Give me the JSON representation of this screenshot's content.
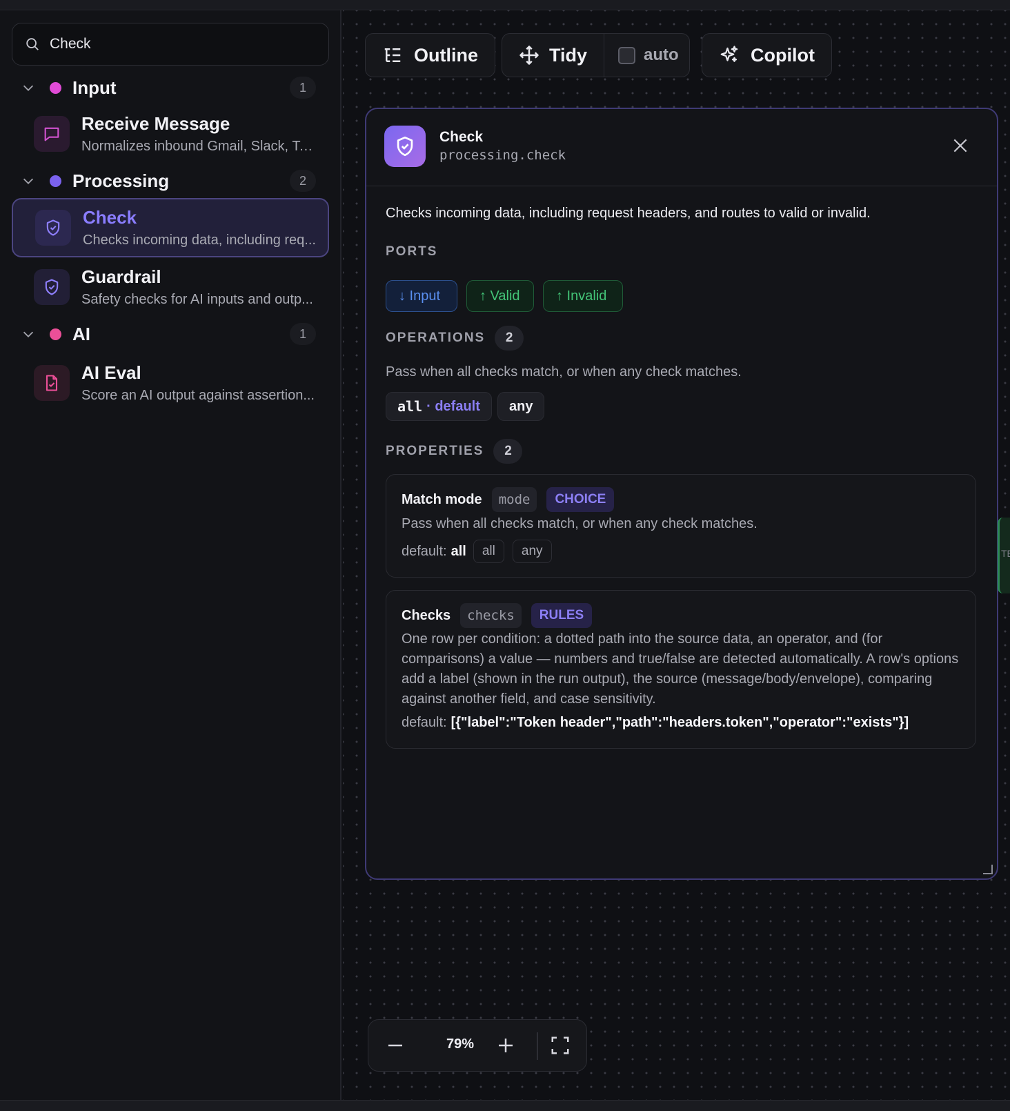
{
  "search": {
    "value": "Check"
  },
  "groups": [
    {
      "name": "Input",
      "count": "1",
      "color": "#e04bd6"
    },
    {
      "name": "Processing",
      "count": "2",
      "color": "#7b62ee"
    },
    {
      "name": "AI",
      "count": "1",
      "color": "#ec4f98"
    }
  ],
  "items": [
    {
      "title": "Receive Message",
      "desc": "Normalizes inbound Gmail, Slack, Tel...",
      "icon": "message-square-icon"
    },
    {
      "title": "Check",
      "desc": "Checks incoming data, including req...",
      "icon": "shield-check-icon"
    },
    {
      "title": "Guardrail",
      "desc": "Safety checks for AI inputs and outp...",
      "icon": "shield-check-icon"
    },
    {
      "title": "AI Eval",
      "desc": "Score an AI output against assertion...",
      "icon": "file-check-icon"
    }
  ],
  "toolbar": {
    "outline": "Outline",
    "tidy": "Tidy",
    "auto": "auto",
    "copilot": "Copilot"
  },
  "panel": {
    "title": "Check",
    "id": "processing.check",
    "description": "Checks incoming data, including request headers, and routes to valid or invalid.",
    "ports_title": "PORTS",
    "ports": [
      "↓ Input",
      "↑ Valid",
      "↑ Invalid"
    ],
    "operations_title": "OPERATIONS",
    "operations_count": "2",
    "operations_desc": "Pass when all checks match, or when any check matches.",
    "op_all": "all",
    "op_default": "· default",
    "op_any": "any",
    "properties_title": "PROPERTIES",
    "properties_count": "2",
    "properties": [
      {
        "name": "Match mode",
        "key": "mode",
        "type": "CHOICE",
        "desc": "Pass when all checks match, or when any check matches.",
        "default_label": "default:",
        "default_value": "all",
        "options": [
          "all",
          "any"
        ]
      },
      {
        "name": "Checks",
        "key": "checks",
        "type": "RULES",
        "desc": "One row per condition: a dotted path into the source data, an operator, and (for comparisons) a value — numbers and true/false are detected automatically. A row's options add a label (shown in the run output), the source (message/body/envelope), comparing against another field, and case sensitivity.",
        "default_label": "default:",
        "default_value": "[{\"label\":\"Token header\",\"path\":\"headers.token\",\"operator\":\"exists\"}]"
      }
    ]
  },
  "edge_label": "TE",
  "zoom": {
    "value": "79%"
  },
  "colors": {
    "accent": "#8a7dff",
    "port_input": "#5a8ff0",
    "port_output": "#43c477"
  }
}
